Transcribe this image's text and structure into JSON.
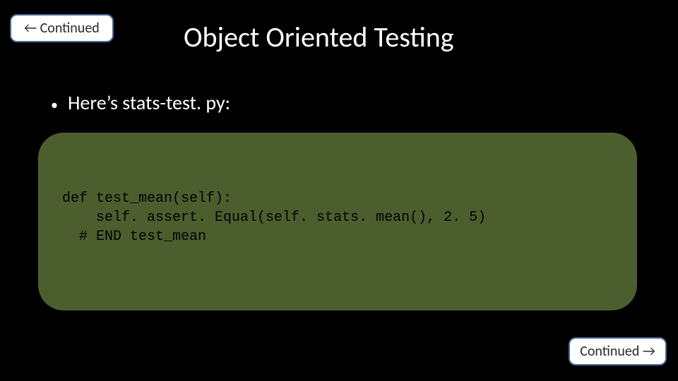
{
  "nav": {
    "back_label": "← Continued",
    "forward_label": "Continued →"
  },
  "slide": {
    "title": "Object Oriented Testing",
    "bullets": [
      "Here’s stats-test. py:"
    ],
    "code": "def test_mean(self):\n    self. assert. Equal(self. stats. mean(), 2. 5)\n  # END test_mean"
  }
}
